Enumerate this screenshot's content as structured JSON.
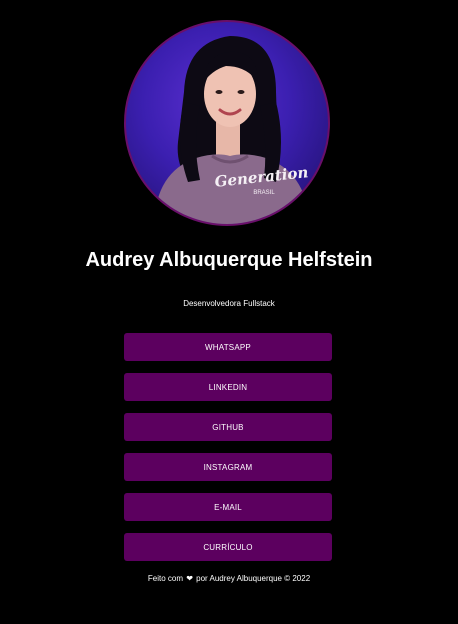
{
  "profile": {
    "name": "Audrey Albuquerque Helfstein",
    "subtitle": "Desenvolvedora Fullstack",
    "shirt_text": "Generation",
    "shirt_subtext": "BRASIL"
  },
  "links": [
    {
      "label": "WHATSAPP",
      "name": "whatsapp-button"
    },
    {
      "label": "LINKEDIN",
      "name": "linkedin-button"
    },
    {
      "label": "GITHUB",
      "name": "github-button"
    },
    {
      "label": "INSTAGRAM",
      "name": "instagram-button"
    },
    {
      "label": "E-MAIL",
      "name": "email-button"
    },
    {
      "label": "CURRÍCULO",
      "name": "curriculo-button"
    }
  ],
  "footer": {
    "before": "Feito com",
    "icon": "heart-icon",
    "after": "por Audrey Albuquerque © 2022"
  },
  "colors": {
    "background": "#000000",
    "button": "#5c005f",
    "avatar_border": "#6a0f6a"
  }
}
